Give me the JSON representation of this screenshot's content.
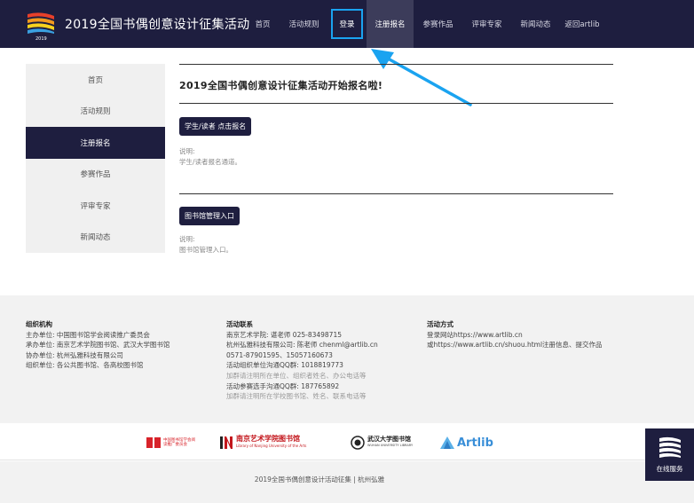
{
  "header": {
    "logo_year": "2019",
    "site_title": "2019全国书偶创意设计征集活动",
    "nav": [
      {
        "label": "首页",
        "name": "nav-home"
      },
      {
        "label": "活动规则",
        "name": "nav-rules"
      },
      {
        "label": "登录",
        "name": "nav-login"
      },
      {
        "label": "注册报名",
        "name": "nav-register"
      },
      {
        "label": "参赛作品",
        "name": "nav-works"
      },
      {
        "label": "评审专家",
        "name": "nav-experts"
      },
      {
        "label": "新闻动态",
        "name": "nav-news"
      },
      {
        "label": "返回artlib",
        "name": "nav-back-artlib"
      }
    ]
  },
  "sidebar": {
    "items": [
      {
        "label": "首页"
      },
      {
        "label": "活动规则"
      },
      {
        "label": "注册报名"
      },
      {
        "label": "参赛作品"
      },
      {
        "label": "评审专家"
      },
      {
        "label": "新闻动态"
      }
    ]
  },
  "main": {
    "title": "2019全国书偶创意设计征集活动开始报名啦!",
    "section1": {
      "button": "学生/读者 点击报名",
      "note_label": "说明:",
      "note_text": "学生/读者报名通道。"
    },
    "section2": {
      "button": "图书馆管理入口",
      "note_label": "说明:",
      "note_text": "图书馆管理入口。"
    }
  },
  "footer": {
    "org": {
      "title": "组织机构",
      "lines": [
        "主办单位: 中国图书馆学会阅读推广委员会",
        "承办单位: 南京艺术学院图书馆、武汉大学图书馆",
        "协办单位: 杭州弘雅科技有限公司",
        "组织单位: 各公共图书馆、各高校图书馆"
      ]
    },
    "contact": {
      "title": "活动联系",
      "lines": [
        "南京艺术学院: 谌老师 025-83498715",
        "杭州弘雅科技有限公司: 陈老师 chenml@artlib.cn",
        "0571-87901595、15057160673",
        "活动组织单位沟通QQ群: 1018819773"
      ],
      "muted1": "加群请注明所在单位、组织者姓名、办公电话等",
      "line5": "活动参赛选手沟通QQ群: 187765892",
      "muted2": "加群请注明所在学校图书馆、姓名、联系电话等"
    },
    "method": {
      "title": "活动方式",
      "lines": [
        "登录网站https://www.artlib.cn",
        "或https://www.artlib.cn/shuou.html注册信息、提交作品"
      ]
    },
    "partners": [
      {
        "name": "中国图书馆学会阅读推广委员会",
        "color": "#d8232a"
      },
      {
        "name": "南京艺术学院图书馆",
        "sub": "Library of Nanjing University of the Arts",
        "color": "#c3161c"
      },
      {
        "name": "武汉大学图书馆",
        "sub": "WUHAN UNIVERSITY LIBRARY",
        "color": "#222222"
      },
      {
        "name": "Artlib",
        "color": "#3a8fd8"
      }
    ],
    "copyright": "2019全国书偶创意设计活动征集 | 杭州弘雅",
    "online_service": "在线服务"
  },
  "colors": {
    "header_bg": "#1e1e3f",
    "highlight": "#1aa3f0",
    "active_nav": "#3c3c5a"
  }
}
